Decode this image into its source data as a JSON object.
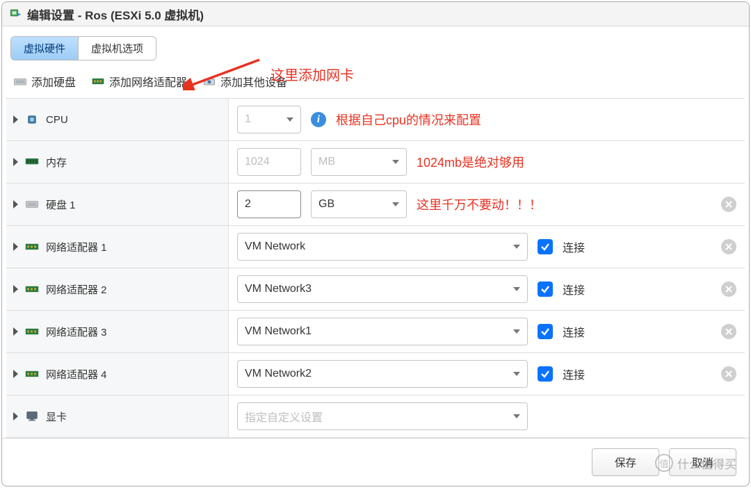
{
  "window": {
    "title": "编辑设置 - Ros (ESXi 5.0 虚拟机)"
  },
  "tabs": {
    "hardware": "虚拟硬件",
    "options": "虚拟机选项"
  },
  "toolbar": {
    "add_disk": "添加硬盘",
    "add_nic": "添加网络适配器",
    "add_other": "添加其他设备"
  },
  "annotations": {
    "add_nic_here": "这里添加网卡",
    "cpu_note": "根据自己cpu的情况来配置",
    "mem_note": "1024mb是绝对够用",
    "disk_note": "这里千万不要动！！！"
  },
  "rows": {
    "cpu": {
      "label": "CPU",
      "value": "1"
    },
    "memory": {
      "label": "内存",
      "value": "1024",
      "unit": "MB"
    },
    "disk": {
      "label": "硬盘 1",
      "value": "2",
      "unit": "GB"
    },
    "nic1": {
      "label": "网络适配器 1",
      "network": "VM Network",
      "connect": "连接"
    },
    "nic2": {
      "label": "网络适配器 2",
      "network": "VM Network3",
      "connect": "连接"
    },
    "nic3": {
      "label": "网络适配器 3",
      "network": "VM Network1",
      "connect": "连接"
    },
    "nic4": {
      "label": "网络适配器 4",
      "network": "VM Network2",
      "connect": "连接"
    },
    "video": {
      "label": "显卡",
      "placeholder": "指定自定义设置"
    }
  },
  "footer": {
    "save": "保存",
    "cancel": "取消"
  },
  "watermark": "什么值得买"
}
